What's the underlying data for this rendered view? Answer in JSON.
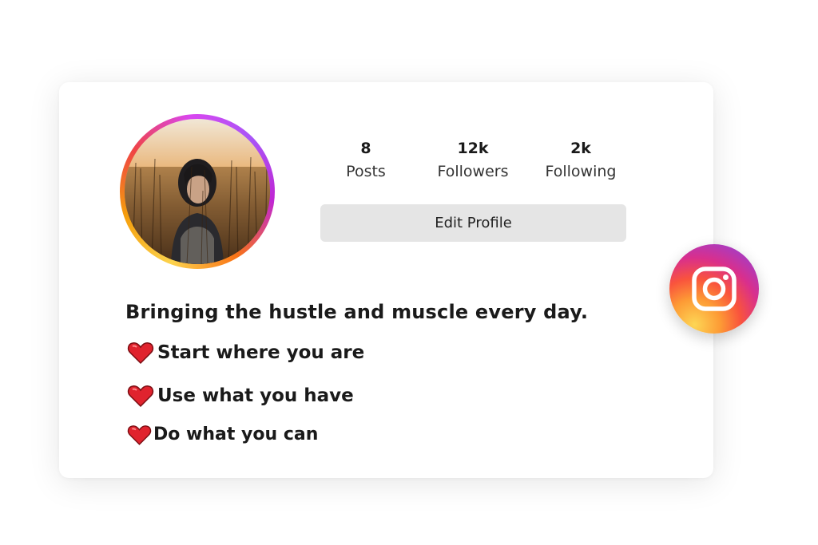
{
  "profile": {
    "stats": [
      {
        "value": "8",
        "label": "Posts"
      },
      {
        "value": "12k",
        "label": "Followers"
      },
      {
        "value": "2k",
        "label": "Following"
      }
    ],
    "edit_button_label": "Edit Profile",
    "avatar_icon": "profile-photo"
  },
  "bio": {
    "headline": "Bringing the hustle and muscle every day.",
    "lines": [
      {
        "icon": "heart-icon",
        "text": "Start where you are"
      },
      {
        "icon": "heart-icon",
        "text": "Use what you have"
      },
      {
        "icon": "heart-icon",
        "text": "Do what you can"
      }
    ]
  },
  "badge": {
    "icon": "instagram-icon"
  },
  "colors": {
    "heart": "#e0232e",
    "button_bg": "#e5e5e5",
    "ring_gold": "#fcd34d",
    "ring_purple": "#a855f7"
  }
}
